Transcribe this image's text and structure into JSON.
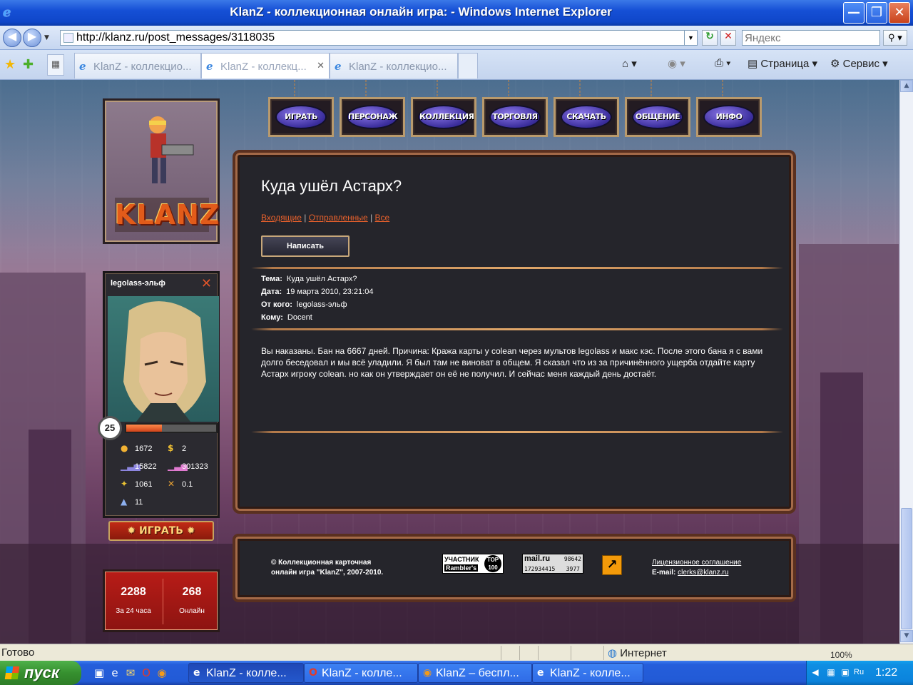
{
  "window": {
    "title": "KlanZ - коллекционная онлайн игра: - Windows Internet Explorer",
    "minimize": "—",
    "maximize": "❐",
    "close": "✕"
  },
  "address": {
    "url": "http://klanz.ru/post_messages/3118035",
    "search_placeholder": "Яндекс"
  },
  "tabs": [
    {
      "label": "KlanZ - коллекцио..."
    },
    {
      "label": "KlanZ - коллекц..."
    },
    {
      "label": "KlanZ - коллекцио..."
    }
  ],
  "commandbar": {
    "page": "Страница",
    "tools": "Сервис"
  },
  "site": {
    "logo": "KLANZ",
    "nav": [
      {
        "label": "ИГРАТЬ"
      },
      {
        "label": "ПЕРСОНАЖ"
      },
      {
        "label": "КОЛЛЕКЦИЯ"
      },
      {
        "label": "ТОРГОВЛЯ"
      },
      {
        "label": "СКАЧАТЬ"
      },
      {
        "label": "ОБЩЕНИЕ"
      },
      {
        "label": "ИНФО"
      }
    ],
    "character": {
      "name": "legolass-эльф",
      "level": "25",
      "xp_fraction": 0.4,
      "stats": {
        "gold": "1672",
        "money": "2",
        "rating1": "15822",
        "rating2": "301323",
        "wins": "1061",
        "ratio": "0.1",
        "extra": "11"
      }
    },
    "play_button": "ИГРАТЬ",
    "online": {
      "day_count": "2288",
      "day_label": "За 24 часа",
      "now_count": "268",
      "now_label": "Онлайн"
    },
    "message": {
      "title": "Куда ушёл Астарх?",
      "links": {
        "inbox": "Входящие",
        "sent": "Отправленные",
        "all": "Все",
        "separator": "|"
      },
      "write_button": "Написать",
      "meta": {
        "subject_label": "Тема:",
        "subject": "Куда ушёл Астарх?",
        "date_label": "Дата:",
        "date": "19 марта 2010, 23:21:04",
        "from_label": "От кого:",
        "from": "legolass-эльф",
        "to_label": "Кому:",
        "to": "Docent"
      },
      "body": "Вы наказаны. Бан на 6667 дней. Причина: Кража карты у colean через мультов legolass и макс кэс. После этого бана я с вами долго беседовал и мы всё уладили. Я был там не виноват в общем. Я сказал что из за причинённого ущерба отдайте карту Астарх игроку colean. но как он утверждает он её не получил. И сейчас меня каждый день достаёт."
    },
    "footer": {
      "copyright_line1": "© Коллекционная карточная",
      "copyright_line2": "онлайн игра \"KlanZ\", 2007-2010.",
      "rambler_top": "УЧАСТНИК",
      "rambler_bottom": "Rambler's",
      "rambler_circle": "TOP 100",
      "mail_logo": "mail.ru",
      "mail_n1": "98642",
      "mail_n2": "172934415",
      "mail_n3": "3977",
      "license": "Лицензионное соглашение",
      "email_label": "E-mail:",
      "email": "clerks@klanz.ru"
    }
  },
  "status": {
    "text": "Готово",
    "zone": "Интернет",
    "zoom": "100%"
  },
  "taskbar": {
    "start": "пуск",
    "tasks": [
      {
        "label": "KlanZ - колле..."
      },
      {
        "label": "KlanZ - колле..."
      },
      {
        "label": "KlanZ – беспл..."
      },
      {
        "label": "KlanZ - колле..."
      }
    ],
    "lang": "Ru",
    "clock": "1:22"
  }
}
